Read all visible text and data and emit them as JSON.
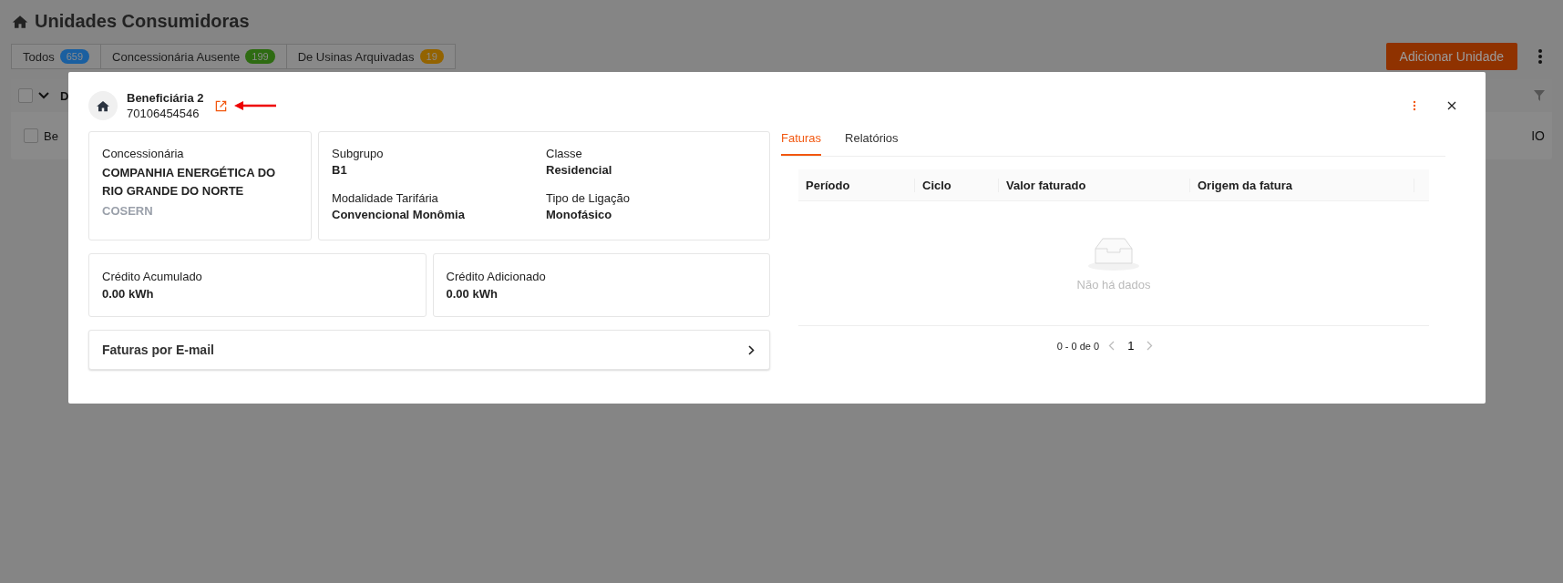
{
  "page": {
    "title": "Unidades Consumidoras",
    "filters": [
      {
        "label": "Todos",
        "count": "659",
        "color": "#1a5fa0"
      },
      {
        "label": "Concessionária Ausente",
        "count": "199",
        "color": "#2e6b12"
      },
      {
        "label": "De Usinas Arquivadas",
        "count": "19",
        "color": "#936300"
      }
    ],
    "add_button": "Adicionar Unidade",
    "table": {
      "header_checked": false,
      "column_1": "D",
      "row_checked": false,
      "row_cell_1": "Be",
      "row_cell_2": "IO"
    }
  },
  "modal": {
    "name": "Beneficiária 2",
    "code": "70106454546",
    "utility": {
      "label": "Concessionária",
      "value": "COMPANHIA ENERGÉTICA DO RIO GRANDE DO NORTE",
      "short": "COSERN"
    },
    "fields": [
      {
        "label": "Subgrupo",
        "value": "B1"
      },
      {
        "label": "Classe",
        "value": "Residencial"
      },
      {
        "label": "Modalidade Tarifária",
        "value": "Convencional Monômia"
      },
      {
        "label": "Tipo de Ligação",
        "value": "Monofásico"
      }
    ],
    "credits": [
      {
        "label": "Crédito Acumulado",
        "value": "0.00 kWh"
      },
      {
        "label": "Crédito Adicionado",
        "value": "0.00 kWh"
      }
    ],
    "email_row": "Faturas por E-mail",
    "tabs": [
      {
        "label": "Faturas",
        "selected": true
      },
      {
        "label": "Relatórios",
        "selected": false
      }
    ],
    "table": {
      "columns": [
        "Período",
        "Ciclo",
        "Valor faturado",
        "Origem da fatura"
      ],
      "empty": "Não há dados"
    },
    "pagination": {
      "range": "0 - 0 de 0",
      "page": "1"
    }
  }
}
